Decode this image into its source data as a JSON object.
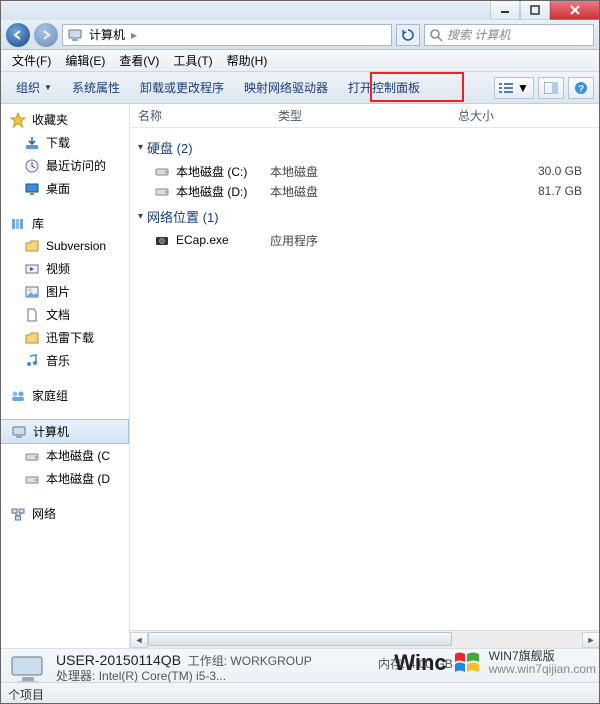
{
  "titlebar": {},
  "address": {
    "location": "计算机",
    "separator": "▸",
    "search_placeholder": "搜索 计算机"
  },
  "menubar": {
    "file": "文件(F)",
    "edit": "编辑(E)",
    "view": "查看(V)",
    "tools": "工具(T)",
    "help": "帮助(H)"
  },
  "toolbar": {
    "organize": "组织",
    "sys_props": "系统属性",
    "uninstall": "卸载或更改程序",
    "map_drive": "映射网络驱动器",
    "open_cp": "打开控制面板"
  },
  "columns": {
    "name": "名称",
    "type": "类型",
    "size": "总大小"
  },
  "sidebar": {
    "favorites": "收藏夹",
    "downloads": "下载",
    "recent": "最近访问的",
    "desktop": "桌面",
    "libraries": "库",
    "subversion": "Subversion",
    "videos": "视频",
    "pictures": "图片",
    "documents": "文档",
    "xunlei": "迅雷下载",
    "music": "音乐",
    "homegroup": "家庭组",
    "computer": "计算机",
    "drive_c": "本地磁盘 (C",
    "drive_d": "本地磁盘 (D",
    "network": "网络"
  },
  "groups": {
    "hdd": {
      "label": "硬盘 (2)"
    },
    "netloc": {
      "label": "网络位置 (1)"
    }
  },
  "items": {
    "c": {
      "name": "本地磁盘 (C:)",
      "type": "本地磁盘",
      "size": "30.0 GB"
    },
    "d": {
      "name": "本地磁盘 (D:)",
      "type": "本地磁盘",
      "size": "81.7 GB"
    },
    "ecap": {
      "name": "ECap.exe",
      "type": "应用程序",
      "size": ""
    }
  },
  "details": {
    "title": "USER-20150114QB",
    "workgroup_label": "工作组:",
    "workgroup": "WORKGROUP",
    "cpu_label": "处理器:",
    "cpu": "Intel(R) Core(TM) i5-3...",
    "mem_label": "内存:",
    "mem": "4.00 GB"
  },
  "watermark": {
    "brand": "Winc",
    "line1": "WIN7旗舰版",
    "line2": "www.win7qijian.com"
  },
  "statusbar": {
    "text": "个项目"
  }
}
